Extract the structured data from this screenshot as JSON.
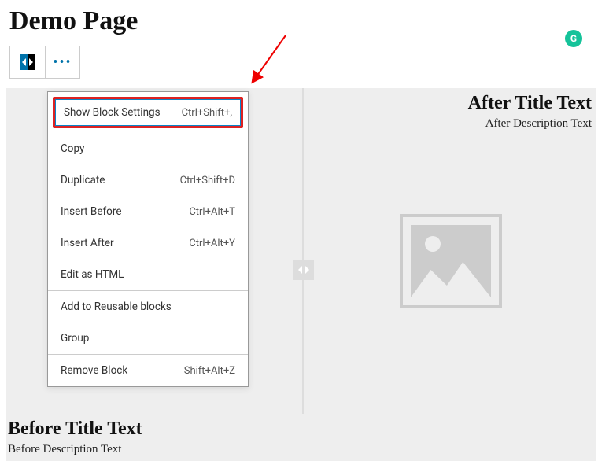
{
  "pageTitle": "Demo Page",
  "toolbar": {
    "compareIcon": "compare-icon",
    "moreIcon": "more-icon"
  },
  "grammarly": "G",
  "menu": {
    "items": [
      {
        "label": "Show Block Settings",
        "shortcut": "Ctrl+Shift+,"
      },
      {
        "label": "Copy",
        "shortcut": ""
      },
      {
        "label": "Duplicate",
        "shortcut": "Ctrl+Shift+D"
      },
      {
        "label": "Insert Before",
        "shortcut": "Ctrl+Alt+T"
      },
      {
        "label": "Insert After",
        "shortcut": "Ctrl+Alt+Y"
      },
      {
        "label": "Edit as HTML",
        "shortcut": ""
      },
      {
        "label": "Add to Reusable blocks",
        "shortcut": ""
      },
      {
        "label": "Group",
        "shortcut": ""
      },
      {
        "label": "Remove Block",
        "shortcut": "Shift+Alt+Z"
      }
    ]
  },
  "after": {
    "title": "After Title Text",
    "desc": "After Description Text"
  },
  "before": {
    "title": "Before Title Text",
    "desc": "Before Description Text"
  }
}
